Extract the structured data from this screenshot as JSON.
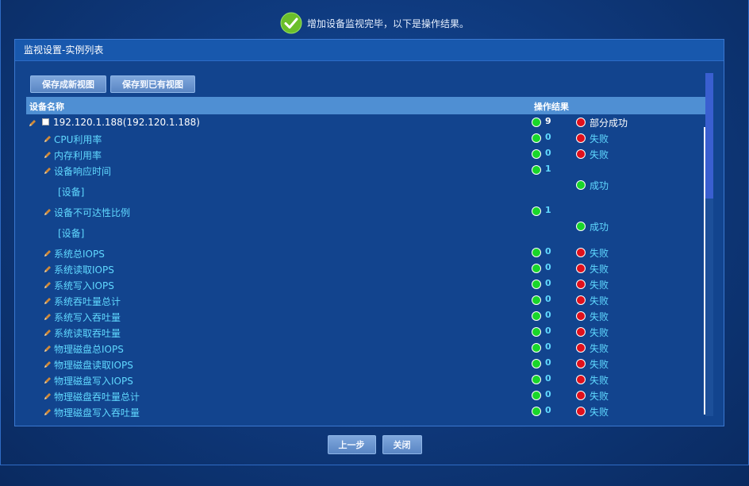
{
  "banner": {
    "message": "增加设备监视完毕，以下是操作结果。",
    "icon": "check-circle-icon",
    "icon_color": "#6bbf2b"
  },
  "panel": {
    "title": "监视设置-实例列表"
  },
  "toolbar": {
    "save_new_view": "保存成新视图",
    "save_existing_view": "保存到已有视图"
  },
  "grid": {
    "col_name": "设备名称",
    "col_result": "操作结果",
    "rows": [
      {
        "kind": "root",
        "name": "192.120.1.188(192.120.1.188)",
        "count": "9",
        "count_status": "green",
        "result": "部分成功",
        "result_status": "red"
      },
      {
        "kind": "item",
        "name": "CPU利用率",
        "count": "0",
        "count_status": "green",
        "result": "失败",
        "result_status": "red"
      },
      {
        "kind": "item",
        "name": "内存利用率",
        "count": "0",
        "count_status": "green",
        "result": "失败",
        "result_status": "red"
      },
      {
        "kind": "tall",
        "name": "设备响应时间",
        "count": "1",
        "count_status": "green",
        "sub": "[设备]",
        "result": "成功",
        "result_status": "green"
      },
      {
        "kind": "tall",
        "name": "设备不可达性比例",
        "count": "1",
        "count_status": "green",
        "sub": "[设备]",
        "result": "成功",
        "result_status": "green"
      },
      {
        "kind": "item",
        "name": "系统总IOPS",
        "count": "0",
        "count_status": "green",
        "result": "失败",
        "result_status": "red"
      },
      {
        "kind": "item",
        "name": "系统读取IOPS",
        "count": "0",
        "count_status": "green",
        "result": "失败",
        "result_status": "red"
      },
      {
        "kind": "item",
        "name": "系统写入IOPS",
        "count": "0",
        "count_status": "green",
        "result": "失败",
        "result_status": "red"
      },
      {
        "kind": "item",
        "name": "系统吞吐量总计",
        "count": "0",
        "count_status": "green",
        "result": "失败",
        "result_status": "red"
      },
      {
        "kind": "item",
        "name": "系统写入吞吐量",
        "count": "0",
        "count_status": "green",
        "result": "失败",
        "result_status": "red"
      },
      {
        "kind": "item",
        "name": "系统读取吞吐量",
        "count": "0",
        "count_status": "green",
        "result": "失败",
        "result_status": "red"
      },
      {
        "kind": "item",
        "name": "物理磁盘总IOPS",
        "count": "0",
        "count_status": "green",
        "result": "失败",
        "result_status": "red"
      },
      {
        "kind": "item",
        "name": "物理磁盘读取IOPS",
        "count": "0",
        "count_status": "green",
        "result": "失败",
        "result_status": "red"
      },
      {
        "kind": "item",
        "name": "物理磁盘写入IOPS",
        "count": "0",
        "count_status": "green",
        "result": "失败",
        "result_status": "red"
      },
      {
        "kind": "item",
        "name": "物理磁盘吞吐量总计",
        "count": "0",
        "count_status": "green",
        "result": "失败",
        "result_status": "red"
      },
      {
        "kind": "item",
        "name": "物理磁盘写入吞吐量",
        "count": "0",
        "count_status": "green",
        "result": "失败",
        "result_status": "red"
      }
    ]
  },
  "footer": {
    "prev": "上一步",
    "close": "关闭"
  }
}
